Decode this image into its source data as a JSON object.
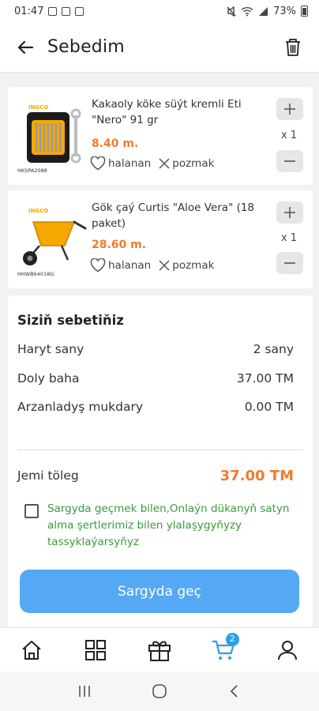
{
  "status_bar": {
    "time": "01:47",
    "battery": "73%"
  },
  "header": {
    "title": "Sebedim"
  },
  "cart_items": [
    {
      "name": "Kakaoly köke süýt kremli Eti \"Nero\" 91 gr",
      "price": "8.40 m.",
      "favorite_label": "halanan",
      "remove_label": "pozmak",
      "quantity": "x 1",
      "image_brand": "INGCO",
      "image_code": "HKSPA2088"
    },
    {
      "name": "Gök çaý Curtis \"Aloe Vera\" (18 paket)",
      "price": "28.60 m.",
      "favorite_label": "halanan",
      "remove_label": "pozmak",
      "quantity": "x 1",
      "image_brand": "INGCO",
      "image_code": "HHWB64018G"
    }
  ],
  "summary": {
    "title": "Siziň sebetiňiz",
    "rows": [
      {
        "label": "Haryt sany",
        "value": "2 sany"
      },
      {
        "label": "Doly baha",
        "value": "37.00 TM"
      },
      {
        "label": "Arzanladyş mukdary",
        "value": "0.00 TM"
      }
    ],
    "total_label": "Jemi töleg",
    "total_value": "37.00 TM",
    "terms_text": "Sargyda geçmek bilen,Onlaýn dükanyň satyn alma şertlerimiz bilen ylalaşygyňyzy tassyklaýarsyňyz",
    "checkout_label": "Sargyda geç"
  },
  "bottom_nav": {
    "items": [
      "home-icon",
      "categories-icon",
      "gift-icon",
      "cart-icon",
      "profile-icon"
    ],
    "cart_badge": "2",
    "active": "cart",
    "active_color": "#2d9fe8"
  },
  "colors": {
    "price": "#f47a2a",
    "button": "#55a8f3",
    "terms": "#3a9a3a"
  }
}
